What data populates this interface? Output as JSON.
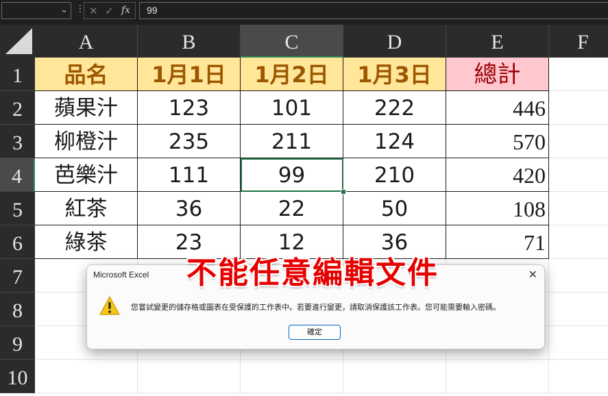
{
  "formula_bar": {
    "name_box": "",
    "cancel_icon": "✕",
    "enter_icon": "✓",
    "fx_label": "fx",
    "formula_value": "99"
  },
  "columns": [
    "A",
    "B",
    "C",
    "D",
    "E",
    "F"
  ],
  "rows": [
    "1",
    "2",
    "3",
    "4",
    "5",
    "6",
    "7",
    "8",
    "9",
    "10"
  ],
  "selected_cell": "C4",
  "table": {
    "headers": [
      "品名",
      "1月1日",
      "1月2日",
      "1月3日",
      "總計"
    ],
    "data": [
      [
        "蘋果汁",
        "123",
        "101",
        "222",
        "446"
      ],
      [
        "柳橙汁",
        "235",
        "211",
        "124",
        "570"
      ],
      [
        "芭樂汁",
        "111",
        "99",
        "210",
        "420"
      ],
      [
        "紅茶",
        "36",
        "22",
        "50",
        "108"
      ],
      [
        "綠茶",
        "23",
        "12",
        "36",
        "71"
      ]
    ]
  },
  "colors": {
    "header_fill": "#ffe699",
    "header_text": "#9c5700",
    "total_fill": "#ffc7ce",
    "total_text": "#9c0006",
    "selection": "#217346",
    "caption": "#e60000"
  },
  "caption": "不能任意編輯文件",
  "dialog": {
    "title": "Microsoft Excel",
    "message": "您嘗試變更的儲存格或圖表在受保護的工作表中。若要進行變更，請取消保護該工作表。您可能需要輸入密碼。",
    "ok_label": "確定",
    "icon": "warning-icon"
  }
}
